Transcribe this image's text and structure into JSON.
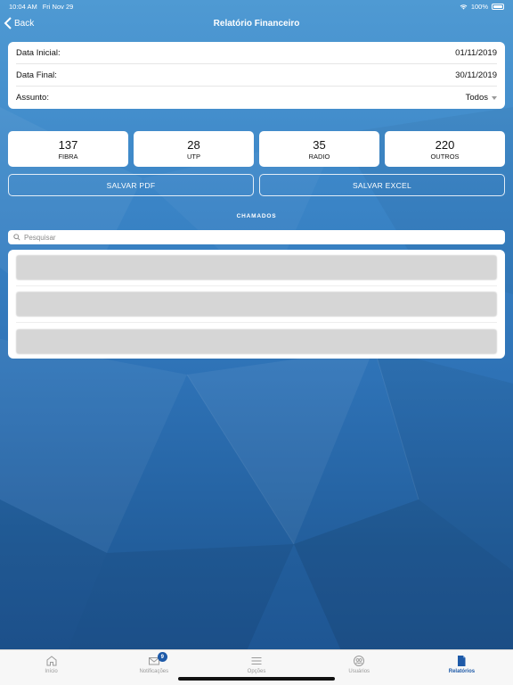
{
  "status_bar": {
    "time": "10:04 AM",
    "date": "Fri Nov 29",
    "battery": "100%"
  },
  "nav": {
    "back_label": "Back",
    "title": "Relatório Financeiro"
  },
  "filters": {
    "start_label": "Data Inicial:",
    "start_value": "01/11/2019",
    "end_label": "Data Final:",
    "end_value": "30/11/2019",
    "subject_label": "Assunto:",
    "subject_value": "Todos"
  },
  "stats": [
    {
      "value": "137",
      "label": "FIBRA"
    },
    {
      "value": "28",
      "label": "UTP"
    },
    {
      "value": "35",
      "label": "RADIO"
    },
    {
      "value": "220",
      "label": "OUTROS"
    }
  ],
  "actions": {
    "pdf_label": "SALVAR PDF",
    "excel_label": "SALVAR EXCEL"
  },
  "section_title": "CHAMADOS",
  "search": {
    "placeholder": "Pesquisar"
  },
  "tabbar": {
    "items": [
      {
        "label": "Início",
        "icon": "home-icon"
      },
      {
        "label": "Notificações",
        "icon": "mail-icon",
        "badge": "9"
      },
      {
        "label": "Opções",
        "icon": "menu-icon"
      },
      {
        "label": "Usuários",
        "icon": "users-icon"
      },
      {
        "label": "Relatórios",
        "icon": "document-icon",
        "active": true
      }
    ]
  },
  "colors": {
    "accent": "#1e5aa8",
    "background": "#2f6fb0"
  }
}
